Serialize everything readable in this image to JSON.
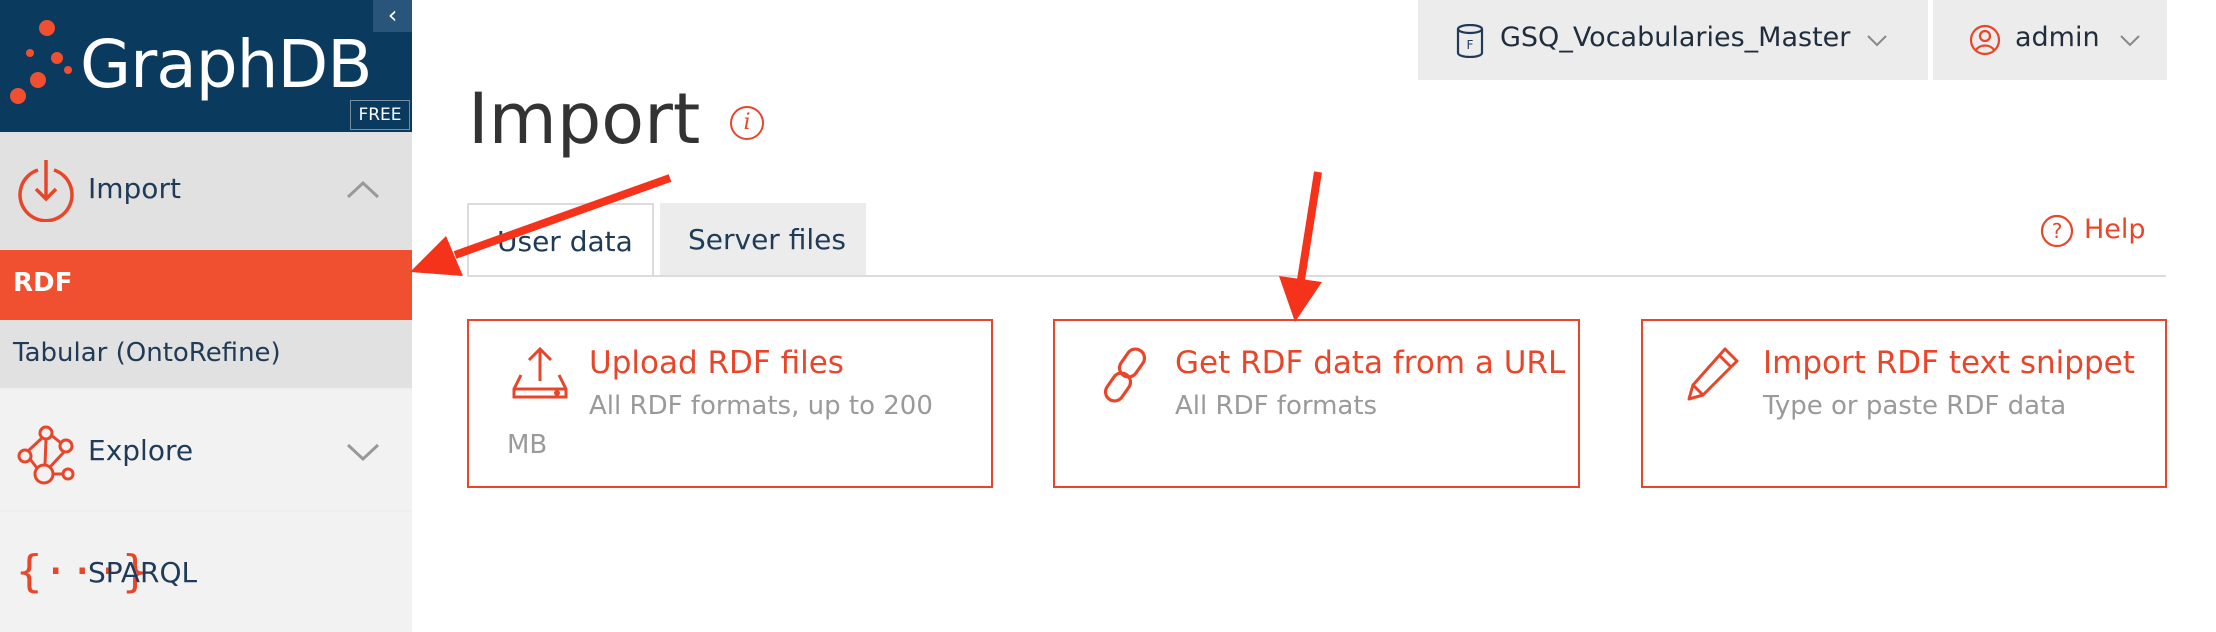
{
  "brand": {
    "name": "GraphDB",
    "badge": "FREE",
    "collapse_glyph": "‹"
  },
  "sidebar": {
    "import": {
      "label": "Import",
      "icon": "import-icon"
    },
    "import_sub": [
      {
        "label": "RDF",
        "active": true
      },
      {
        "label": "Tabular (OntoRefine)",
        "active": false
      }
    ],
    "explore": {
      "label": "Explore",
      "icon": "explore-icon"
    },
    "sparql": {
      "label": "SPARQL",
      "icon": "sparql-icon"
    }
  },
  "topbar": {
    "repository": "GSQ_Vocabularies_Master",
    "user": "admin"
  },
  "page": {
    "title": "Import",
    "help_label": "Help"
  },
  "tabs": [
    {
      "label": "User data",
      "active": true
    },
    {
      "label": "Server files",
      "active": false
    }
  ],
  "cards": [
    {
      "title": "Upload RDF files",
      "subtitle_line1": "All RDF formats, up to 200",
      "subtitle_line2": "MB",
      "icon": "upload-icon"
    },
    {
      "title": "Get RDF data from a URL",
      "subtitle_line1": "All RDF formats",
      "icon": "link-icon"
    },
    {
      "title": "Import RDF text snippet",
      "subtitle_line1": "Type or paste RDF data",
      "icon": "pencil-icon"
    }
  ],
  "colors": {
    "accent": "#e8462a",
    "brand_bg": "#0b3a5f",
    "active_nav": "#f05030",
    "annotation_arrow": "#f5321a"
  }
}
